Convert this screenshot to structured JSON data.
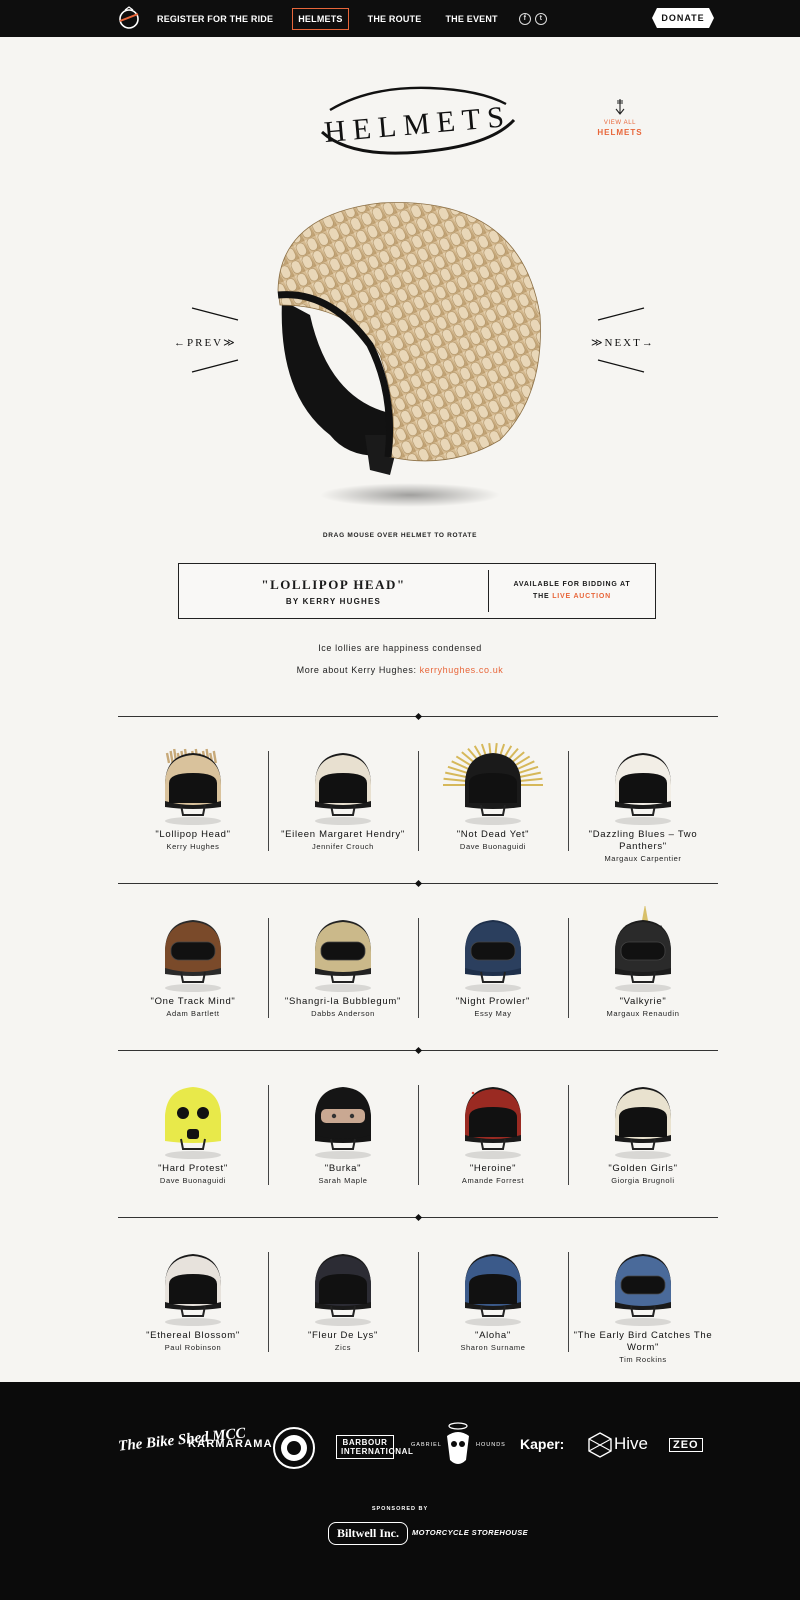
{
  "nav": {
    "links": [
      "Register for the ride",
      "Helmets",
      "The route",
      "The event"
    ],
    "active_index": 1,
    "social": [
      "f",
      "t"
    ],
    "donate": "DONATE"
  },
  "header": {
    "title": "HELMETS",
    "view_all_small": "VIEW ALL",
    "view_all_big": "HELMETS"
  },
  "hero": {
    "prev": "PREV",
    "next": "NEXT",
    "drag_hint": "DRAG MOUSE OVER HELMET TO ROTATE"
  },
  "featured": {
    "name": "\"LOLLIPOP HEAD\"",
    "by": "BY KERRY HUGHES",
    "available_line1": "AVAILABLE FOR BIDDING AT",
    "available_the": "THE ",
    "available_link": "LIVE AUCTION",
    "tagline": "Ice lollies are happiness condensed",
    "more_about_prefix": "More about Kerry Hughes: ",
    "more_about_link": "kerryhughes.co.uk"
  },
  "helmets": [
    {
      "name": "\"Lollipop Head\"",
      "artist": "Kerry Hughes",
      "style": "lollipop"
    },
    {
      "name": "\"Eileen Margaret Hendry\"",
      "artist": "Jennifer Crouch",
      "style": "pompom"
    },
    {
      "name": "\"Not Dead Yet\"",
      "artist": "Dave Buonaguidi",
      "style": "spikes"
    },
    {
      "name": "\"Dazzling Blues – Two Panthers\"",
      "artist": "Margaux Carpentier",
      "style": "dazzle"
    },
    {
      "name": "\"One Track Mind\"",
      "artist": "Adam Bartlett",
      "style": "flame"
    },
    {
      "name": "\"Shangri-la Bubblegum\"",
      "artist": "Dabbs Anderson",
      "style": "shangri"
    },
    {
      "name": "\"Night Prowler\"",
      "artist": "Essy May",
      "style": "navy"
    },
    {
      "name": "\"Valkyrie\"",
      "artist": "Margaux Renaudin",
      "style": "valkyrie"
    },
    {
      "name": "\"Hard Protest\"",
      "artist": "Dave Buonaguidi",
      "style": "yellow"
    },
    {
      "name": "\"Burka\"",
      "artist": "Sarah Maple",
      "style": "burka"
    },
    {
      "name": "\"Heroine\"",
      "artist": "Amande Forrest",
      "style": "red"
    },
    {
      "name": "\"Golden Girls\"",
      "artist": "Giorgia Brugnoli",
      "style": "golden"
    },
    {
      "name": "\"Ethereal Blossom\"",
      "artist": "Paul Robinson",
      "style": "blossom"
    },
    {
      "name": "\"Fleur De Lys\"",
      "artist": "Zics",
      "style": "fleur"
    },
    {
      "name": "\"Aloha\"",
      "artist": "Sharon Surname",
      "style": "aloha"
    },
    {
      "name": "\"The Early Bird Catches The Worm\"",
      "artist": "Tim Rockins",
      "style": "earlybird"
    }
  ],
  "footer": {
    "logos": [
      "The Bike Shed MCC",
      "KARMARAMA",
      "Bikers Roundel",
      "BARBOUR INTERNATIONAL",
      "GABRIEL",
      "HOUNDS",
      "Kaper:",
      "Hive",
      "ZEO"
    ],
    "sponsored_by": "SPONSORED BY",
    "sponsors": [
      "Biltwell Inc.",
      "MOTORCYCLE STOREHOUSE"
    ]
  },
  "colors": {
    "accent": "#e8663a",
    "nav_bg": "#0e0e0e",
    "page_bg": "#f6f5f2"
  }
}
